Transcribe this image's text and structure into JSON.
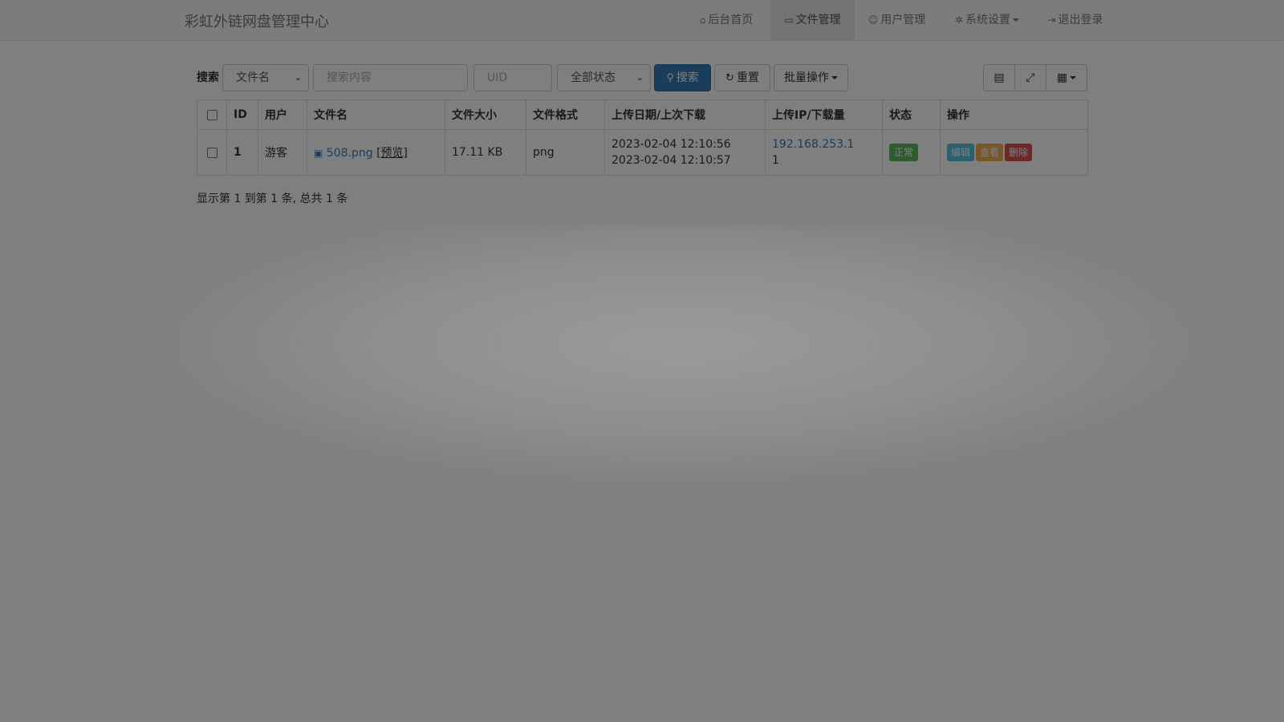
{
  "brand": "彩虹外链网盘管理中心",
  "nav": [
    {
      "label": "后台首页",
      "icon": "home-icon",
      "glyph": "⌂",
      "active": false
    },
    {
      "label": "文件管理",
      "icon": "folder-open-icon",
      "glyph": "▭",
      "active": true
    },
    {
      "label": "用户管理",
      "icon": "users-icon",
      "glyph": "☺",
      "active": false
    },
    {
      "label": "系统设置",
      "icon": "gear-icon",
      "glyph": "✲",
      "active": false,
      "dropdown": true
    },
    {
      "label": "退出登录",
      "icon": "logout-icon",
      "glyph": "⇥",
      "active": false
    }
  ],
  "toolbar": {
    "search_label": "搜索",
    "field_select": "文件名",
    "search_placeholder": "搜索内容",
    "uid_placeholder": "UID",
    "status_select": "全部状态",
    "search_button": "搜索",
    "reset_button": "重置",
    "batch_button": "批量操作",
    "search_icon": "search-icon",
    "reset_icon": "refresh-icon",
    "view_icons": [
      "list-view-icon",
      "fullscreen-icon",
      "columns-icon"
    ]
  },
  "table": {
    "headers": [
      "ID",
      "用户",
      "文件名",
      "文件大小",
      "文件格式",
      "上传日期/上次下载",
      "上传IP/下载量",
      "状态",
      "操作"
    ],
    "rows": [
      {
        "id": "1",
        "user": "游客",
        "file_icon": "image-file-icon",
        "filename": "508.png",
        "preview": "[预览]",
        "size": "17.11 KB",
        "format": "png",
        "upload_date": "2023-02-04 12:10:56",
        "last_download": "2023-02-04 12:10:57",
        "ip": "192.168.253.1",
        "downloads": "1",
        "status": "正常",
        "actions": [
          "编辑",
          "查看",
          "删除"
        ]
      }
    ]
  },
  "page_info": "显示第 1 到第 1 条, 总共 1 条"
}
